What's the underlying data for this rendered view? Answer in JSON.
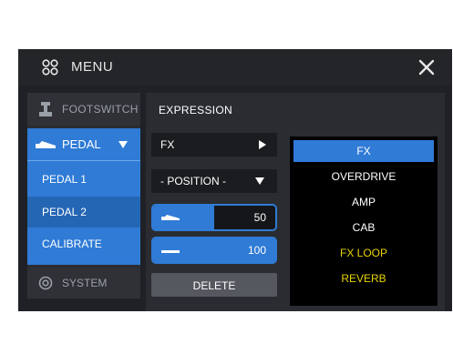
{
  "header": {
    "title": "MENU",
    "menu_icon": "grid-icon",
    "close_icon": "close-icon"
  },
  "sidebar": {
    "footswitch": {
      "label": "FOOTSWITCH",
      "icon": "footswitch-icon"
    },
    "pedal": {
      "label": "PEDAL",
      "icon": "pedal-icon",
      "expanded": true
    },
    "sub_items": [
      {
        "label": "PEDAL 1",
        "selected": false
      },
      {
        "label": "PEDAL 2",
        "selected": true
      },
      {
        "label": "CALIBRATE",
        "selected": false
      }
    ],
    "system": {
      "label": "SYSTEM",
      "icon": "gear-icon"
    }
  },
  "main": {
    "title": "EXPRESSION",
    "fx_selector": {
      "label": "FX"
    },
    "position_dropdown": {
      "value": "- POSITION -"
    },
    "sliders": [
      {
        "value": "50",
        "fraction": 0.5
      },
      {
        "value": "100",
        "fraction": 1.0
      }
    ],
    "delete_label": "DELETE",
    "fx_list": [
      {
        "label": "FX",
        "selected": true,
        "color": "white"
      },
      {
        "label": "OVERDRIVE",
        "selected": false,
        "color": "white"
      },
      {
        "label": "AMP",
        "selected": false,
        "color": "white"
      },
      {
        "label": "CAB",
        "selected": false,
        "color": "white"
      },
      {
        "label": "FX LOOP",
        "selected": false,
        "color": "yellow"
      },
      {
        "label": "REVERB",
        "selected": false,
        "color": "yellow"
      }
    ]
  },
  "colors": {
    "accent": "#2f7bd6",
    "accent_dark": "#2566b4",
    "yellow": "#e8d400",
    "bg": "#1f2126"
  }
}
